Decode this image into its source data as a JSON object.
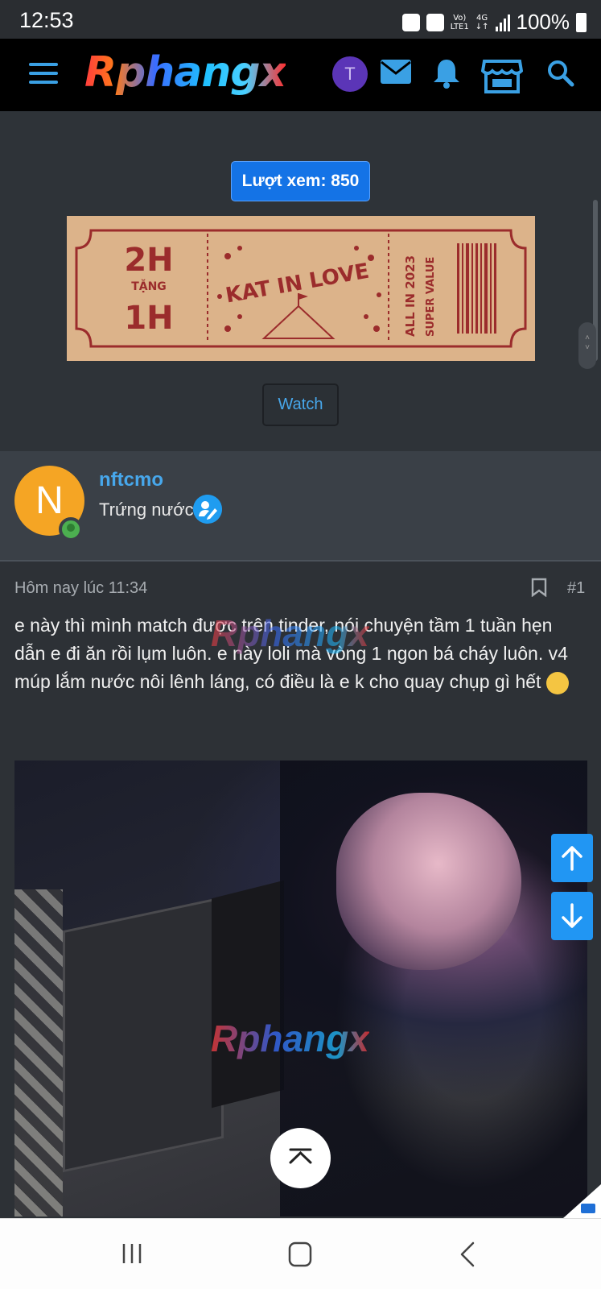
{
  "status_bar": {
    "time": "12:53",
    "network_top": "Vo)",
    "network_bottom": "LTE1",
    "network_type_top": "4G",
    "network_type_bottom": "↓↑",
    "battery": "100%"
  },
  "nav": {
    "logo_text": "Rphangx",
    "avatar_letter": "T",
    "icons": [
      "menu-icon",
      "mail-icon",
      "bell-icon",
      "store-icon",
      "search-icon"
    ],
    "accent_color": "#3aa0e4"
  },
  "ad": {
    "views_label": "Lượt xem: 850",
    "ticket": {
      "left_big_top": "2H",
      "left_small": "TẶNG",
      "left_big_bottom": "1H",
      "center_title": "KAT IN LOVE",
      "right_line1": "ALL IN 2023",
      "right_line2": "SUPER VALUE"
    },
    "watch_button": "Watch"
  },
  "user": {
    "avatar_letter": "N",
    "name": "nftcmo",
    "title": "Trứng nước"
  },
  "post": {
    "time": "Hôm nay lúc 11:34",
    "number": "#1",
    "body": "e này thì mình match được trên tinder, nói chuyện tầm 1 tuần hẹn dẫn e đi ăn rồi lụm luôn. e này loli mà vòng 1 ngon bá cháy luôn. v4 múp lắm nước nôi lênh láng, có điều là e k cho quay chụp gì hết",
    "watermark": "Rphangx"
  }
}
